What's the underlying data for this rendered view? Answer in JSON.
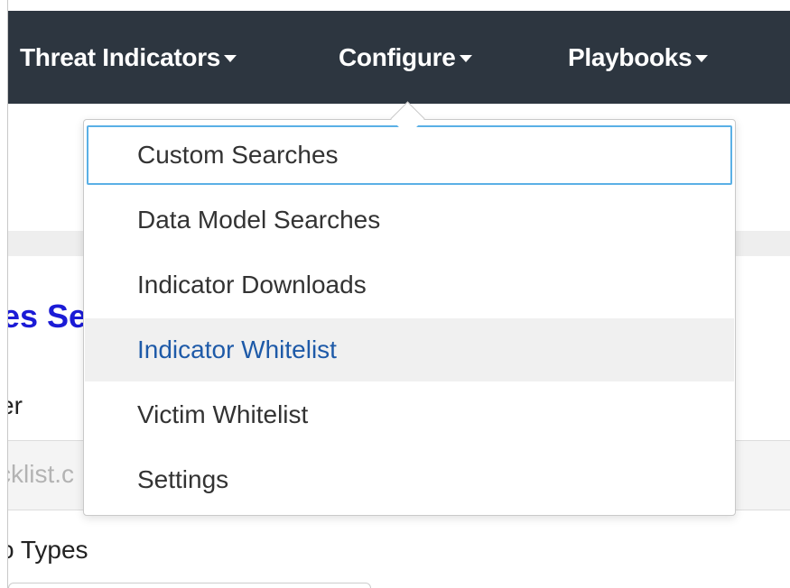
{
  "navbar": {
    "items": [
      {
        "label": "Threat Indicators",
        "icon": "caret-down-icon"
      },
      {
        "label": "Configure",
        "icon": "caret-down-icon"
      },
      {
        "label": "Playbooks",
        "icon": "caret-down-icon"
      }
    ]
  },
  "configure_menu": {
    "items": [
      {
        "label": "Custom Searches",
        "state": "focused"
      },
      {
        "label": "Data Model Searches",
        "state": "normal"
      },
      {
        "label": "Indicator Downloads",
        "state": "normal"
      },
      {
        "label": "Indicator Whitelist",
        "state": "hovered"
      },
      {
        "label": "Victim Whitelist",
        "state": "normal"
      },
      {
        "label": "Settings",
        "state": "normal"
      }
    ]
  },
  "background": {
    "heading_partial": "es Se",
    "field_label_partial": "er",
    "field_value_partial": "cklist.c",
    "types_label_partial": "o Types"
  },
  "colors": {
    "navbar_bg": "#2d3640",
    "heading_blue": "#1b1bd6",
    "focus_ring": "#5ab0e6",
    "hover_text": "#1e5aa8"
  }
}
